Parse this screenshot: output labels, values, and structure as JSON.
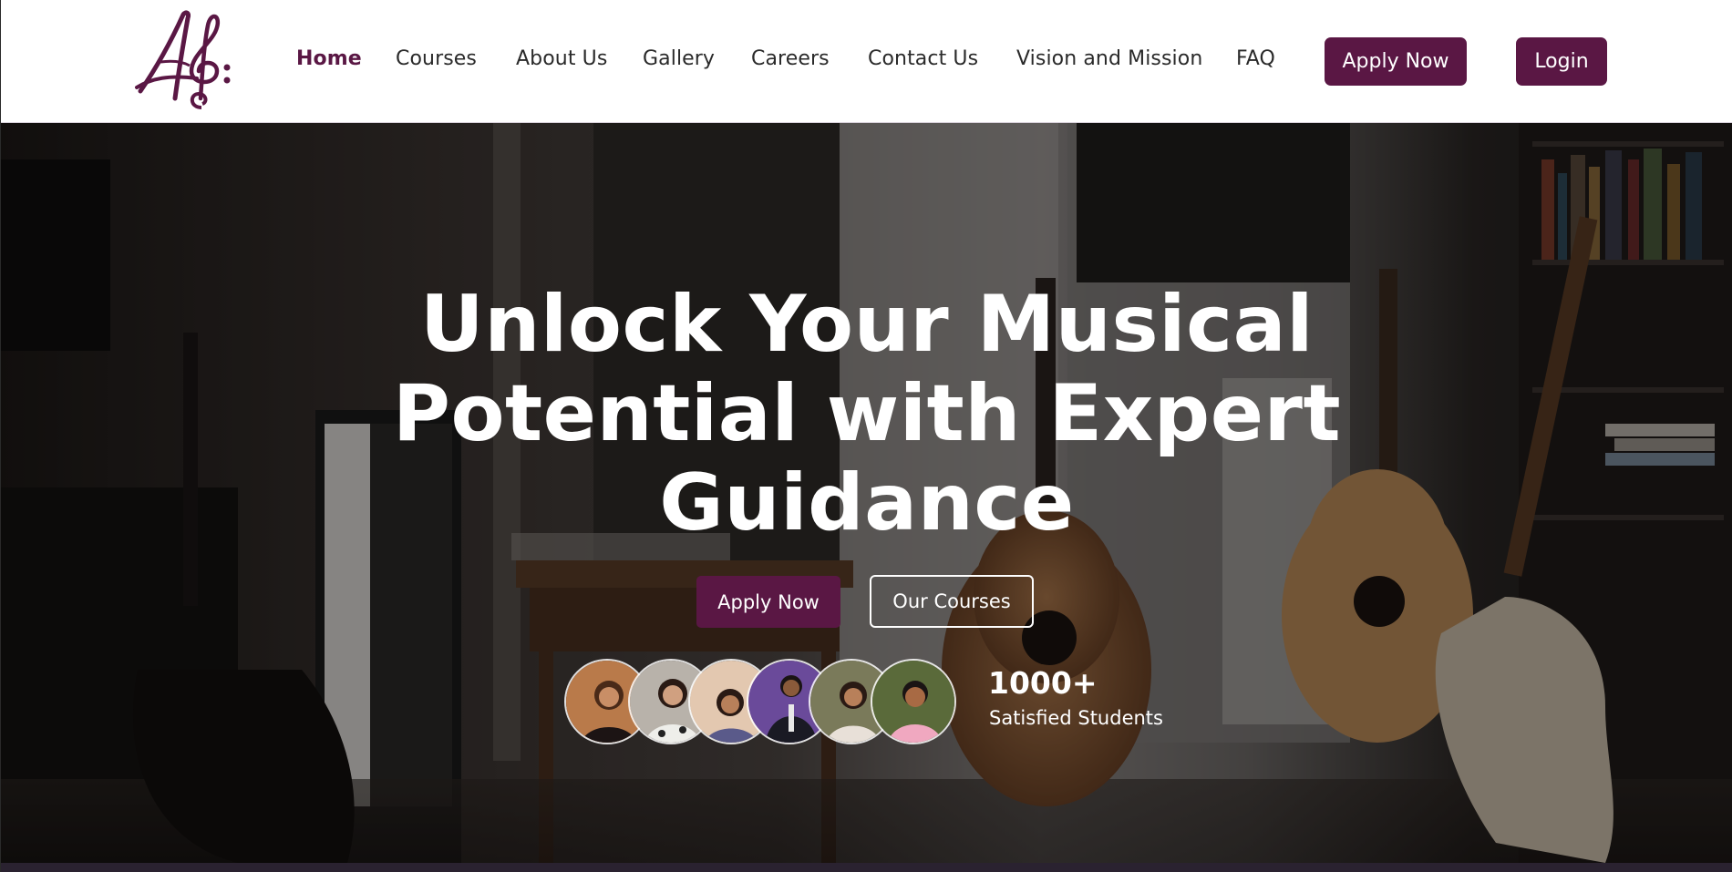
{
  "header": {
    "logo_alt": "Music academy treble clef logo",
    "nav": [
      {
        "label": "Home",
        "active": true
      },
      {
        "label": "Courses",
        "active": false
      },
      {
        "label": "About Us",
        "active": false
      },
      {
        "label": "Gallery",
        "active": false
      },
      {
        "label": "Careers",
        "active": false
      },
      {
        "label": "Contact Us",
        "active": false
      },
      {
        "label": "Vision and Mission",
        "active": false
      },
      {
        "label": "FAQ",
        "active": false
      }
    ],
    "apply_label": "Apply Now",
    "login_label": "Login"
  },
  "hero": {
    "title_lines": [
      "Unlock Your Musical",
      "Potential with Expert",
      "Guidance"
    ],
    "apply_label": "Apply Now",
    "courses_label": "Our Courses",
    "students_count": "1000+",
    "students_label": "Satisfied Students"
  },
  "colors": {
    "brand": "#5a1744",
    "header_bg": "#ffffff",
    "nav_text": "#2a2a2a",
    "hero_text": "#ffffff"
  },
  "icons": [
    "logo-icon",
    "student-avatar"
  ]
}
